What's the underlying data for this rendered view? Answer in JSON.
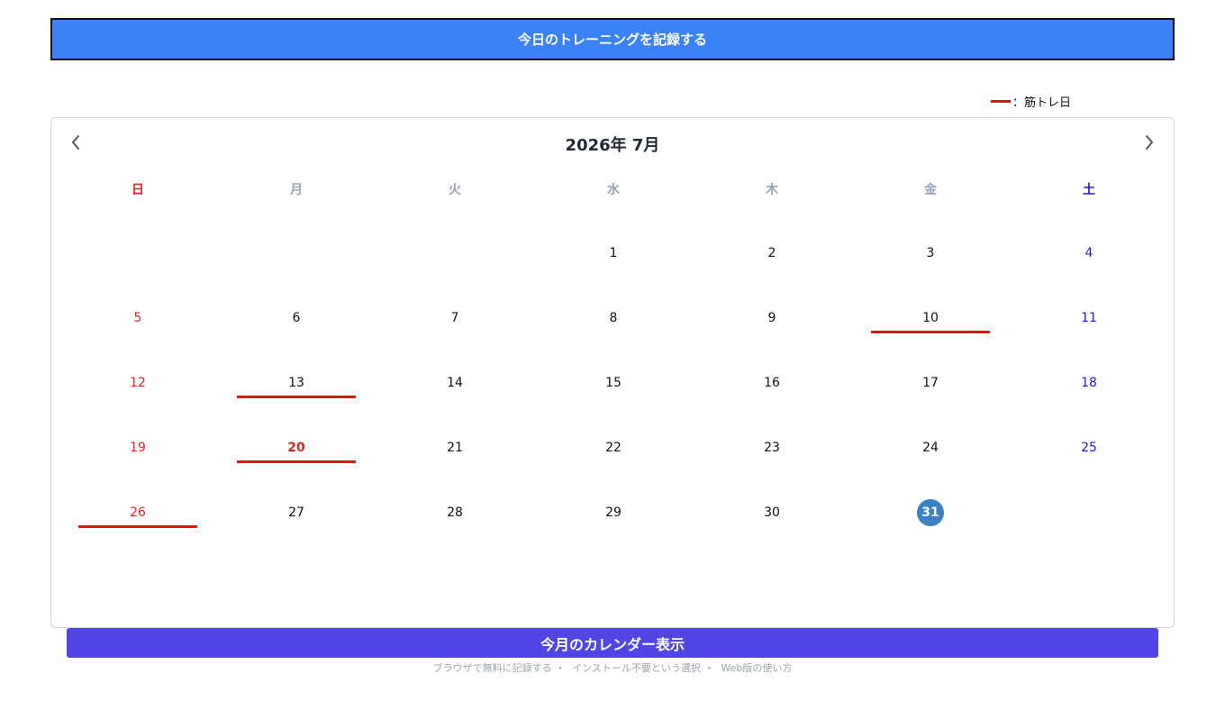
{
  "record_button": {
    "label": "今日のトレーニングを記録する"
  },
  "legend": {
    "label": "：筋トレ日",
    "color": "#ee1111"
  },
  "calendar": {
    "title": "2026年 7月",
    "prev_icon": "chevron-left-icon",
    "next_icon": "chevron-right-icon",
    "weekdays": [
      "日",
      "月",
      "火",
      "水",
      "木",
      "金",
      "土"
    ],
    "today": 31,
    "training_days": [
      10,
      13,
      20,
      26
    ],
    "holidays": [
      20
    ],
    "days": {
      "1": "1",
      "2": "2",
      "3": "3",
      "4": "4",
      "5": "5",
      "6": "6",
      "7": "7",
      "8": "8",
      "9": "9",
      "10": "10",
      "11": "11",
      "12": "12",
      "13": "13",
      "14": "14",
      "15": "15",
      "16": "16",
      "17": "17",
      "18": "18",
      "19": "19",
      "20": "20",
      "21": "21",
      "22": "22",
      "23": "23",
      "24": "24",
      "25": "25",
      "26": "26",
      "27": "27",
      "28": "28",
      "29": "29",
      "30": "30",
      "31": "31"
    }
  },
  "month_button": {
    "label": "今月のカレンダー表示"
  },
  "footer": {
    "links": [
      "ブラウザで無料に記録する",
      "インストール不要という選択",
      "Web版の使い方"
    ],
    "separator": "・"
  },
  "colors": {
    "accent_blue": "#3b82f6",
    "month_button": "#4f46e5",
    "sunday": "#dc2626",
    "saturday": "#1d1dc9",
    "today_circle": "#3b82c4"
  }
}
